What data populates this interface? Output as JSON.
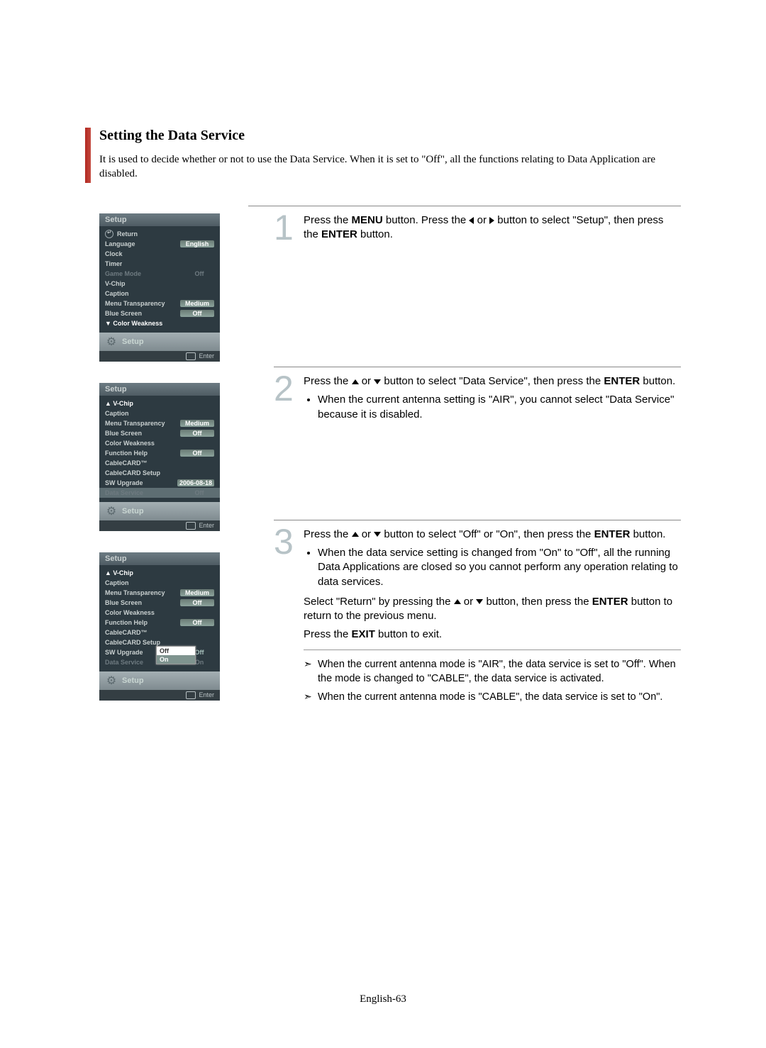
{
  "title": "Setting the Data Service",
  "intro": "It is used to decide whether or not to use the Data Service. When it is set to \"Off\", all the functions relating to Data Application are disabled.",
  "menus": {
    "title": "Setup",
    "lower_label": "Setup",
    "enter_label": "Enter",
    "panel1": {
      "return": "Return",
      "rows": [
        {
          "label": "Language",
          "value": "English",
          "style": "hl"
        },
        {
          "label": "Clock",
          "value": "",
          "style": ""
        },
        {
          "label": "Timer",
          "value": "",
          "style": ""
        },
        {
          "label": "Game Mode",
          "value": "Off",
          "style": "dim"
        },
        {
          "label": "V-Chip",
          "value": "",
          "style": ""
        },
        {
          "label": "Caption",
          "value": "",
          "style": ""
        },
        {
          "label": "Menu Transparency",
          "value": "Medium",
          "style": "hl"
        },
        {
          "label": "Blue Screen",
          "value": "Off",
          "style": "hl"
        },
        {
          "label": "▼ Color Weakness",
          "value": "",
          "style": "sel"
        }
      ]
    },
    "panel2": {
      "top": "▲ V-Chip",
      "rows": [
        {
          "label": "Caption",
          "value": "",
          "style": ""
        },
        {
          "label": "Menu Transparency",
          "value": "Medium",
          "style": "hl"
        },
        {
          "label": "Blue Screen",
          "value": "Off",
          "style": "hl"
        },
        {
          "label": "Color Weakness",
          "value": "",
          "style": ""
        },
        {
          "label": "Function Help",
          "value": "Off",
          "style": "hl"
        },
        {
          "label": "CableCARD™",
          "value": "",
          "style": ""
        },
        {
          "label": "CableCARD Setup",
          "value": "",
          "style": ""
        },
        {
          "label": "SW Upgrade",
          "value": "2006-08-18",
          "style": "hl"
        },
        {
          "label": "Data Service",
          "value": "Off",
          "style": "dim selected-row"
        }
      ]
    },
    "panel3": {
      "top": "▲ V-Chip",
      "rows": [
        {
          "label": "Caption",
          "value": "",
          "style": ""
        },
        {
          "label": "Menu Transparency",
          "value": "Medium",
          "style": "hl"
        },
        {
          "label": "Blue Screen",
          "value": "Off",
          "style": "hl"
        },
        {
          "label": "Color Weakness",
          "value": "",
          "style": ""
        },
        {
          "label": "Function Help",
          "value": "Off",
          "style": "hl"
        },
        {
          "label": "CableCARD™",
          "value": "",
          "style": ""
        },
        {
          "label": "CableCARD Setup",
          "value": "",
          "style": ""
        },
        {
          "label": "SW Upgrade",
          "value": "Off",
          "style": ""
        },
        {
          "label": "Data Service",
          "value": "On",
          "style": "dim"
        }
      ],
      "popup": {
        "opt1": "Off",
        "opt2": "On"
      }
    }
  },
  "steps": {
    "s1": {
      "num": "1",
      "p1a": "Press the ",
      "p1b": "MENU",
      "p1c": " button. Press the ",
      "p1d": " or ",
      "p1e": " button to select \"Setup\", then press the ",
      "p1f": "ENTER",
      "p1g": " button."
    },
    "s2": {
      "num": "2",
      "p1a": "Press the ",
      "p1b": " or ",
      "p1c": " button to select \"Data Service\", then press the ",
      "p1d": "ENTER",
      "p1e": " button.",
      "bullet": "When the current antenna setting is \"AIR\", you cannot select \"Data Service\" because it is disabled."
    },
    "s3": {
      "num": "3",
      "p1a": "Press the ",
      "p1b": " or ",
      "p1c": " button to select \"Off\" or \"On\", then press the ",
      "p1d": "ENTER",
      "p1e": " button.",
      "bullet": "When the data service setting is changed from \"On\" to \"Off\", all the running Data Applications are closed so you cannot perform any operation relating to data services.",
      "p2a": "Select \"Return\" by pressing the ",
      "p2b": " or ",
      "p2c": " button, then press the ",
      "p2d": "ENTER",
      "p2e": " button to return to the previous menu.",
      "p3a": "Press the ",
      "p3b": "EXIT",
      "p3c": " button to exit."
    }
  },
  "notes": {
    "n1": "When the current antenna mode is \"AIR\", the data service is set to \"Off\". When the mode is changed to \"CABLE\", the data service is activated.",
    "n2": "When the current antenna mode is \"CABLE\", the data service is set to \"On\"."
  },
  "footer": "English-63"
}
